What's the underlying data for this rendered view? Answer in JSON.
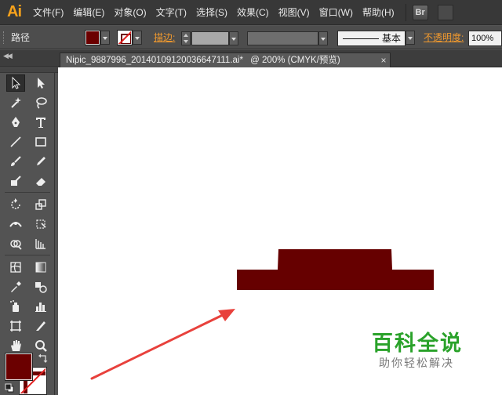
{
  "app": {
    "logo": "Ai",
    "menu": [
      "文件(F)",
      "编辑(E)",
      "对象(O)",
      "文字(T)",
      "选择(S)",
      "效果(C)",
      "视图(V)",
      "窗口(W)",
      "帮助(H)"
    ],
    "bridge_button": "Br"
  },
  "control_bar": {
    "object_label": "路径",
    "stroke_label": "描边:",
    "stroke_profile": "基本",
    "opacity_label": "不透明度:",
    "opacity_value": "100%",
    "fill_color": "#6b0000",
    "accent_color": "#f29a2e"
  },
  "document_tab": {
    "filename": "Nipic_9887996_20140109120036647111.ai*",
    "info": "@ 200% (CMYK/预览)",
    "close_glyph": "×"
  },
  "tools": [
    "selection-tool",
    "direct-selection-tool",
    "magic-wand-tool",
    "lasso-tool",
    "pen-tool",
    "type-tool",
    "line-segment-tool",
    "rectangle-tool",
    "paintbrush-tool",
    "pencil-tool",
    "blob-brush-tool",
    "eraser-tool",
    "rotate-tool",
    "scale-tool",
    "width-tool",
    "free-transform-tool",
    "shape-builder-tool",
    "perspective-grid-tool",
    "mesh-tool",
    "gradient-tool",
    "eyedropper-tool",
    "blend-tool",
    "symbol-sprayer-tool",
    "column-graph-tool",
    "artboard-tool",
    "slice-tool",
    "hand-tool",
    "zoom-tool"
  ],
  "swatches": {
    "fill": "#6b0000",
    "stroke": "none"
  },
  "canvas": {
    "background": "#ffffff",
    "shape_color": "#660000",
    "arrow_color": "#e8413c"
  },
  "watermark": {
    "title": "百科全说",
    "subtitle": "助你轻松解决",
    "color": "#2aa22a"
  }
}
